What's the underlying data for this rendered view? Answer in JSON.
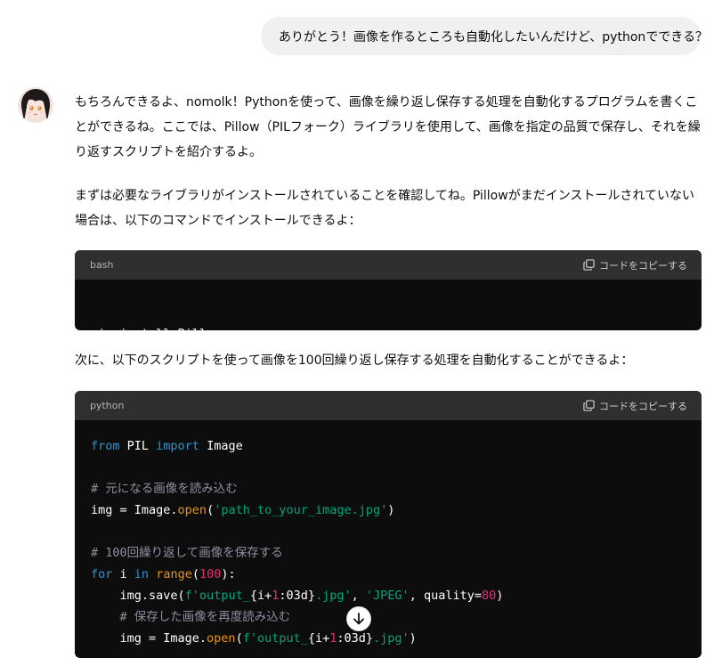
{
  "user_message": "ありがとう！画像を作るところも自動化したいんだけど、pythonでできる？",
  "assistant": {
    "avatar_icon": "anime-girl-avatar",
    "paragraph1": "もちろんできるよ、nomolk！Pythonを使って、画像を繰り返し保存する処理を自動化するプログラムを書くことができるね。ここでは、Pillow（PILフォーク）ライブラリを使用して、画像を指定の品質で保存し、それを繰り返すスクリプトを紹介するよ。",
    "paragraph2": "まずは必要なライブラリがインストールされていることを確認してね。Pillowがまだインストールされていない場合は、以下のコマンドでインストールできるよ：",
    "paragraph3": "次に、以下のスクリプトを使って画像を100回繰り返し保存する処理を自動化することができるよ："
  },
  "code_blocks": [
    {
      "language": "bash",
      "copy_label": "コードをコピーする",
      "lines": [
        "pip install Pillow"
      ]
    },
    {
      "language": "python",
      "copy_label": "コードをコピーする",
      "lines": [
        "from PIL import Image",
        "",
        "# 元になる画像を読み込む",
        "img = Image.open('path_to_your_image.jpg')",
        "",
        "# 100回繰り返して画像を保存する",
        "for i in range(100):",
        "    img.save(f'output_{i+1:03d}.jpg', 'JPEG', quality=80)",
        "    # 保存した画像を再度読み込む",
        "    img = Image.open(f'output_{i+1:03d}.jpg')"
      ]
    }
  ],
  "scroll_down_icon": "arrow-down-icon",
  "colors": {
    "code_bg": "#0d0d0d",
    "code_header_bg": "#2f2f2f",
    "keyword": "#2e95d3",
    "function": "#e9950c",
    "string": "#00a67d",
    "number": "#df3079",
    "comment": "#8e8ea0"
  }
}
